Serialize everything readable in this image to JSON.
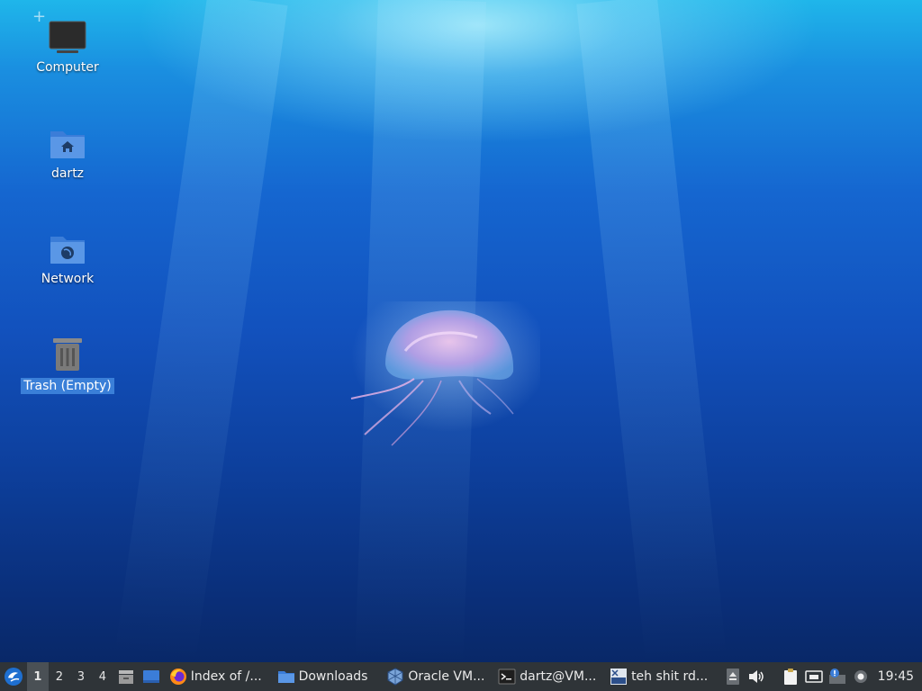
{
  "desktop": {
    "icons": [
      {
        "label": "Computer",
        "icon": "computer-icon"
      },
      {
        "label": "dartz",
        "icon": "home-folder-icon"
      },
      {
        "label": "Network",
        "icon": "network-folder-icon"
      },
      {
        "label": "Trash (Empty)",
        "icon": "trash-icon",
        "selected": true
      }
    ]
  },
  "taskbar": {
    "start_icon": "lubuntu-menu-icon",
    "workspaces": [
      "1",
      "2",
      "3",
      "4"
    ],
    "active_workspace": "1",
    "quicklaunch": [
      "file-manager-icon",
      "show-desktop-icon"
    ],
    "tasks": [
      {
        "label": "Index of /...",
        "icon": "firefox-icon"
      },
      {
        "label": "Downloads",
        "icon": "folder-icon"
      },
      {
        "label": "Oracle VM...",
        "icon": "virtualbox-icon"
      },
      {
        "label": "dartz@VM...",
        "icon": "terminal-icon"
      },
      {
        "label": "teh shit rd...",
        "icon": "rdp-icon"
      }
    ],
    "tray": [
      "eject-icon",
      "volume-icon",
      "clipboard-icon",
      "network-wired-icon",
      "update-notifier-icon",
      "settings-icon"
    ],
    "clock": "19:45"
  }
}
